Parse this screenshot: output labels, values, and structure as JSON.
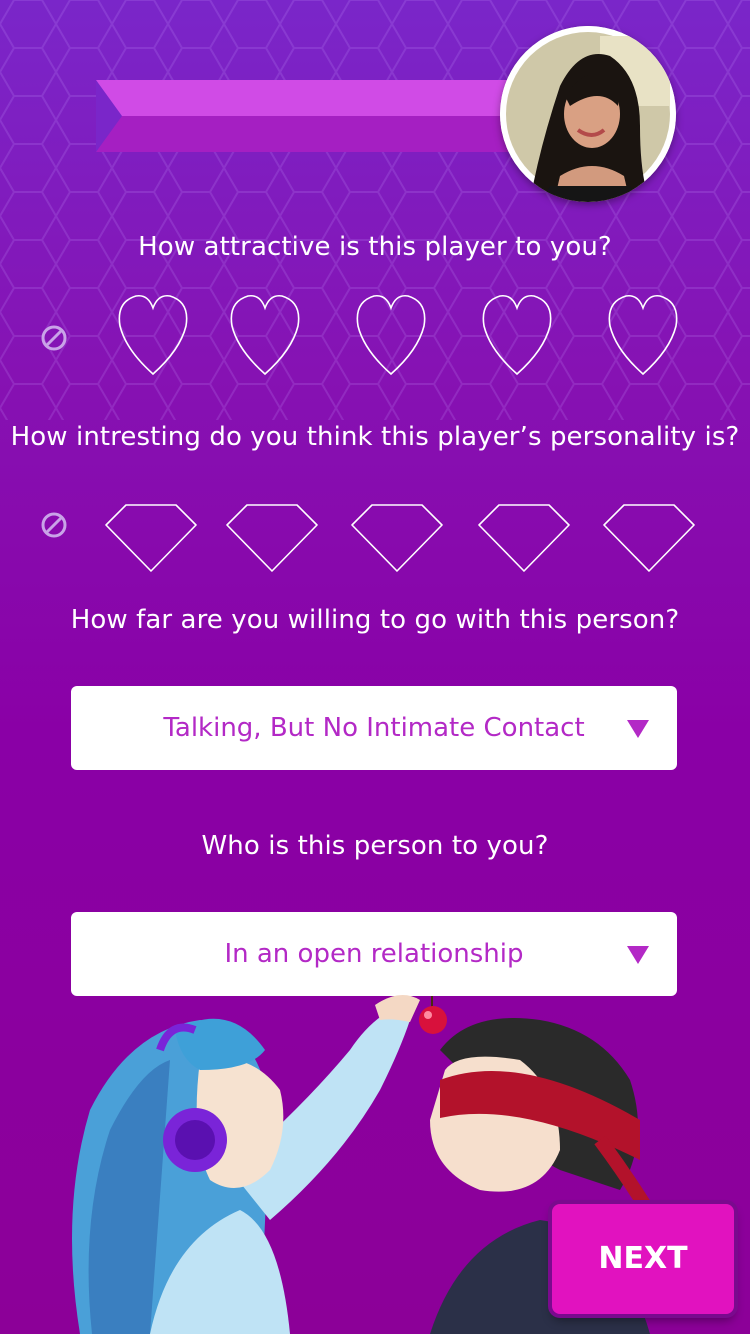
{
  "profile": {
    "banner_icon": "ribbon-banner",
    "avatar_icon": "profile-photo"
  },
  "questions": {
    "attractive": "How attractive is this player to you?",
    "personality": "How intresting do you think this player’s personality is?",
    "how_far": "How far are you willing to go with this person?",
    "who": "Who is this person to you?"
  },
  "ratings": {
    "attractive": {
      "max": 5,
      "value": 0,
      "icon": "heart-icon"
    },
    "personality": {
      "max": 5,
      "value": 0,
      "icon": "diamond-icon"
    }
  },
  "dropdowns": {
    "how_far": {
      "selected": "Talking, But No Intimate Contact"
    },
    "who": {
      "selected": "In an open relationship"
    }
  },
  "buttons": {
    "next": "NEXT"
  },
  "colors": {
    "accent": "#e112bf",
    "dropdown_text": "#b329c6",
    "background_top": "#7a26c9",
    "background_bottom": "#8c0098"
  }
}
